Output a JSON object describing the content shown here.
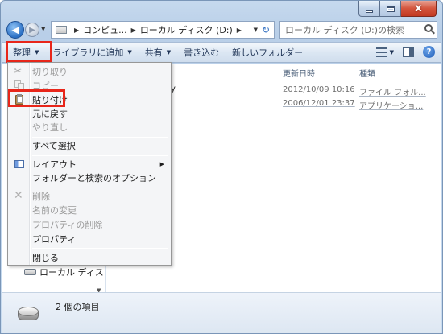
{
  "window": {
    "caption": {
      "minimize_glyph": "_",
      "maximize_glyph": "□",
      "close_glyph": "x"
    }
  },
  "address": {
    "crumbs": [
      "コンピュ...",
      "ローカル ディスク (D:)"
    ],
    "search_placeholder": "ローカル ディスク (D:)の検索"
  },
  "commandbar": {
    "organize": "整理",
    "add_to_library": "ライブラリに追加",
    "share": "共有",
    "burn": "書き込む",
    "new_folder": "新しいフォルダー"
  },
  "organize_menu": {
    "items": [
      {
        "label": "切り取り",
        "enabled": false,
        "icon": "scissors-icon"
      },
      {
        "label": "コピー",
        "enabled": false,
        "icon": "copy-icon"
      },
      {
        "label": "貼り付け",
        "enabled": true,
        "icon": "clipboard-icon"
      },
      {
        "label": "元に戻す",
        "enabled": true
      },
      {
        "label": "やり直し",
        "enabled": false
      },
      {
        "label": "すべて選択",
        "enabled": true
      },
      {
        "label": "レイアウト",
        "enabled": true,
        "icon": "layout-icon",
        "submenu": true
      },
      {
        "label": "フォルダーと検索のオプション",
        "enabled": true
      },
      {
        "label": "削除",
        "enabled": false,
        "icon": "delete-icon"
      },
      {
        "label": "名前の変更",
        "enabled": false
      },
      {
        "label": "プロパティの削除",
        "enabled": false
      },
      {
        "label": "プロパティ",
        "enabled": true
      },
      {
        "label": "閉じる",
        "enabled": true
      }
    ]
  },
  "file_list": {
    "columns": [
      "更新日時",
      "種類"
    ],
    "rows": [
      {
        "name_fragment": "y",
        "modified": "2012/10/09 10:16",
        "type": "ファイル フォル..."
      },
      {
        "name_fragment": "",
        "modified": "2006/12/01 23:37",
        "type": "アプリケーショ..."
      }
    ]
  },
  "nav_pane": {
    "local_disk": "ローカル ディス"
  },
  "status": {
    "item_count": "2 個の項目"
  },
  "colors": {
    "highlight_red": "#e8261a",
    "window_frame": "#c6d9ee"
  }
}
